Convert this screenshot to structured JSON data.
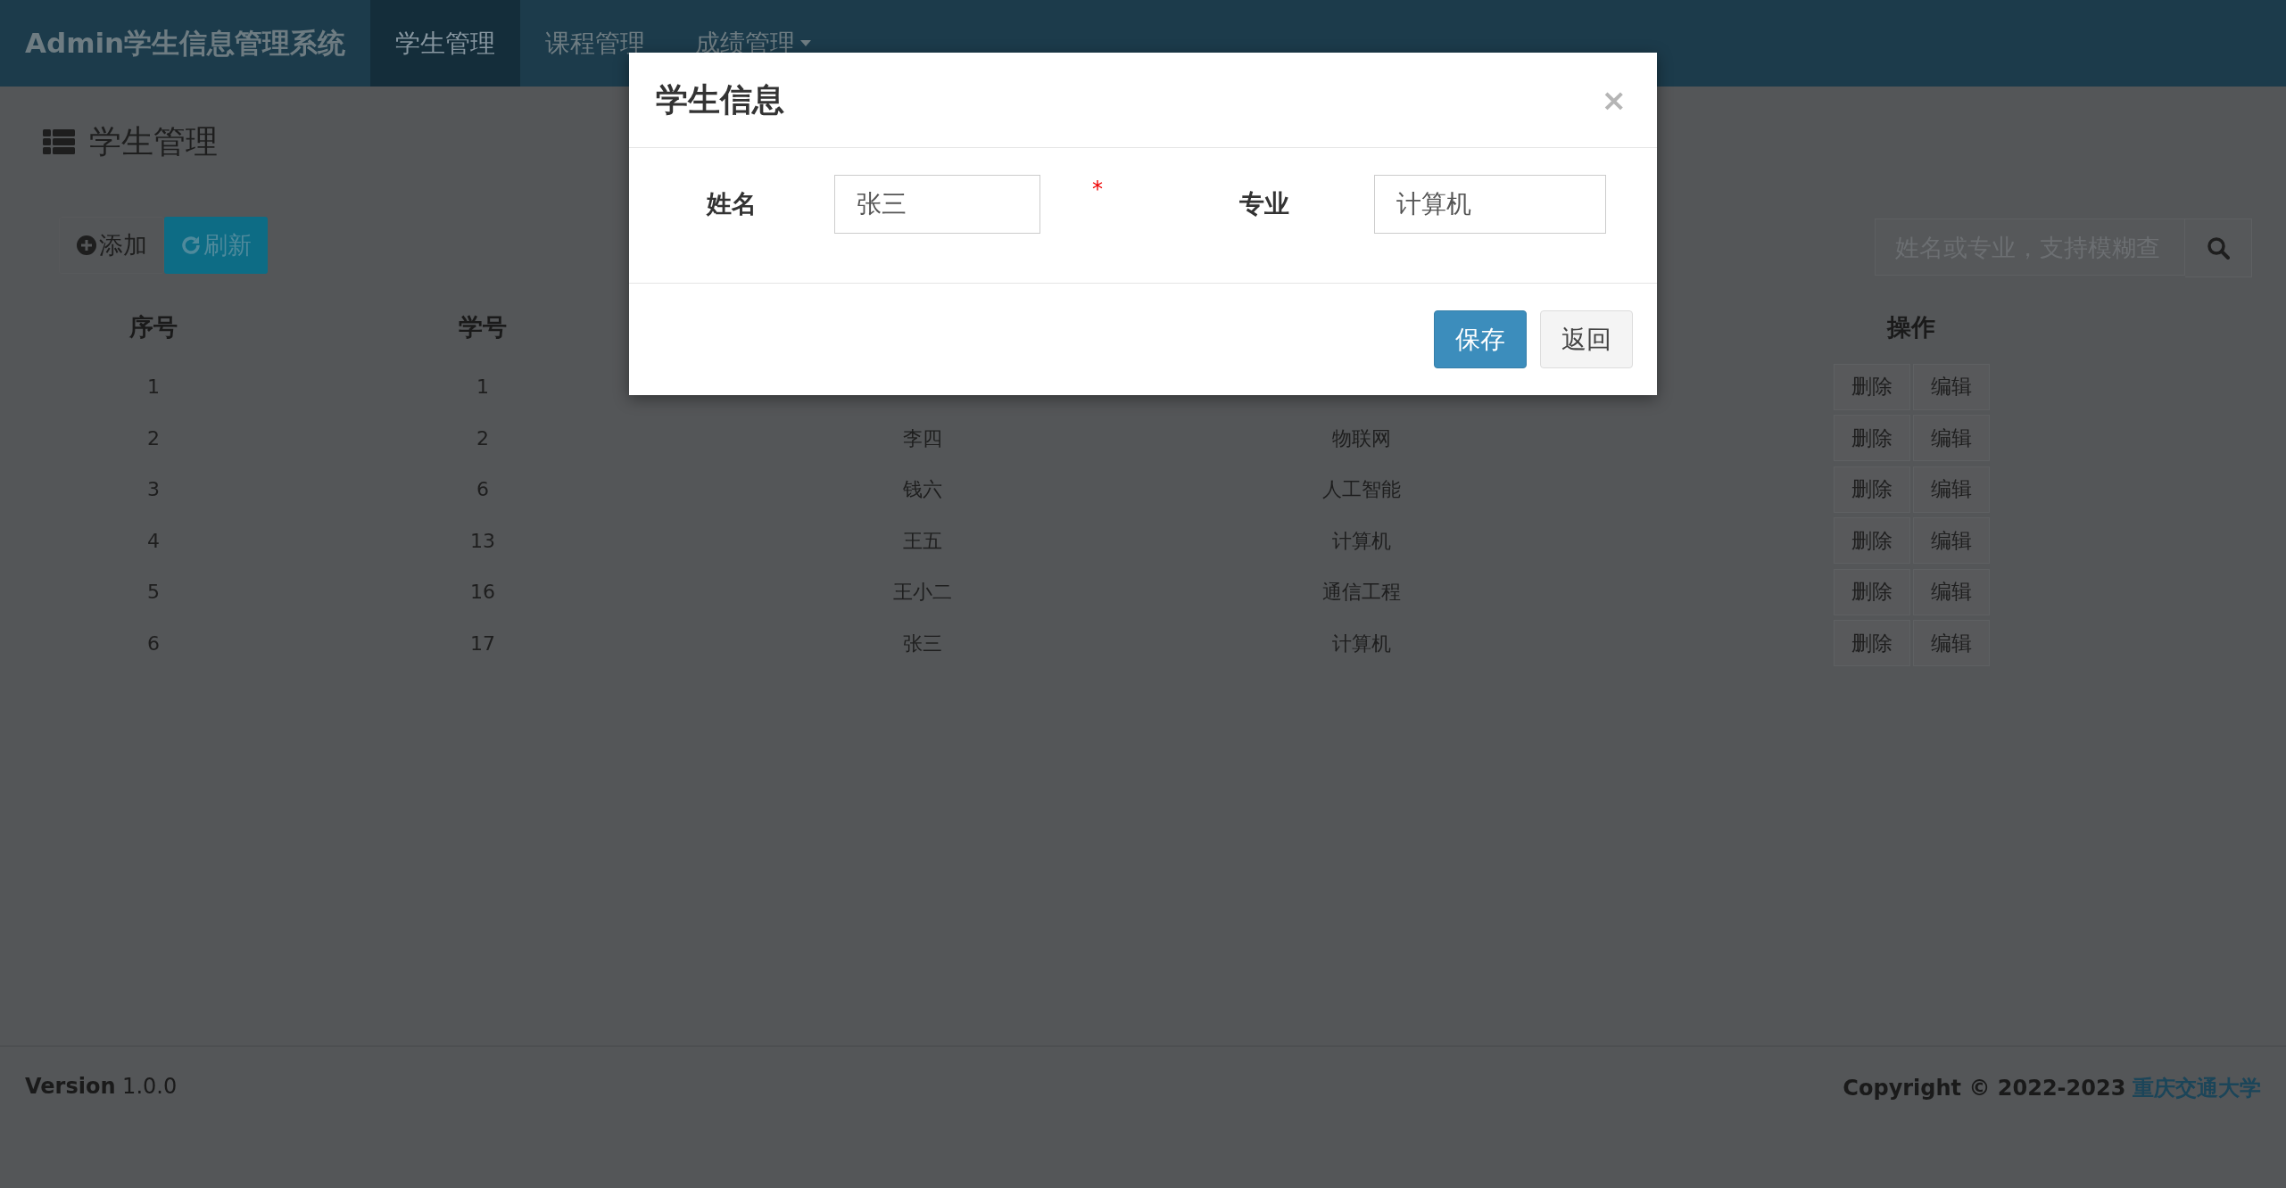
{
  "navbar": {
    "brand": "Admin学生信息管理系统",
    "items": [
      {
        "label": "学生管理",
        "selected": true,
        "kind": "link"
      },
      {
        "label": "课程管理",
        "selected": false,
        "kind": "link"
      },
      {
        "label": "成绩管理",
        "selected": false,
        "kind": "dropdown"
      }
    ]
  },
  "page": {
    "title": "学生管理",
    "toolbar": [
      {
        "label": "添加",
        "kind": "add"
      },
      {
        "label": "刷新",
        "kind": "refresh"
      }
    ],
    "search": {
      "placeholder": "姓名或专业，支持模糊查"
    }
  },
  "table": {
    "columns": [
      "序号",
      "学号",
      null,
      null,
      "操作"
    ],
    "rows": [
      {
        "cells": [
          "1",
          "1",
          null,
          null
        ],
        "actions": [
          "删除",
          "编辑"
        ]
      },
      {
        "cells": [
          "2",
          "2",
          "李四",
          "物联网"
        ],
        "actions": [
          "删除",
          "编辑"
        ]
      },
      {
        "cells": [
          "3",
          "6",
          "钱六",
          "人工智能"
        ],
        "actions": [
          "删除",
          "编辑"
        ]
      },
      {
        "cells": [
          "4",
          "13",
          "王五",
          "计算机"
        ],
        "actions": [
          "删除",
          "编辑"
        ]
      },
      {
        "cells": [
          "5",
          "16",
          "王小二",
          "通信工程"
        ],
        "actions": [
          "删除",
          "编辑"
        ]
      },
      {
        "cells": [
          "6",
          "17",
          "张三",
          "计算机"
        ],
        "actions": [
          "删除",
          "编辑"
        ]
      }
    ]
  },
  "modal": {
    "title": "学生信息",
    "close": "×",
    "fields": [
      {
        "label": "姓名",
        "value": "张三",
        "marker": "*"
      },
      {
        "label": "专业",
        "value": "计算机"
      }
    ],
    "buttons": [
      {
        "label": "保存",
        "kind": "primary"
      },
      {
        "label": "返回",
        "kind": "default"
      }
    ]
  },
  "footer": {
    "version_label": "Version",
    "version": "1.0.0",
    "copyright": "Copyright © 2022-2023",
    "link": "重庆交通大学"
  }
}
